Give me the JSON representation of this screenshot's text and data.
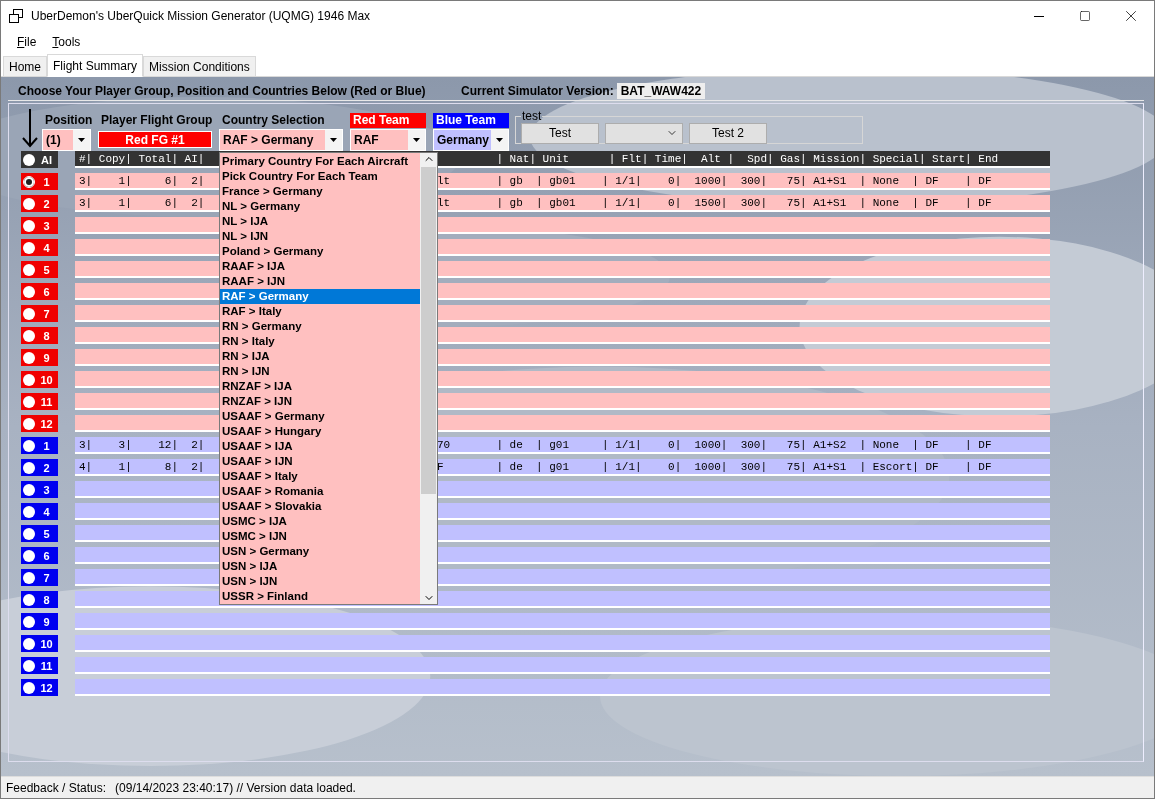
{
  "window": {
    "title": "UberDemon's UberQuick Mission Generator (UQMG) 1946 Max"
  },
  "menu": [
    {
      "label": "File"
    },
    {
      "label": "Tools"
    }
  ],
  "tabs": [
    {
      "label": "Home",
      "selected": false
    },
    {
      "label": "Flight Summary",
      "selected": true
    },
    {
      "label": "Mission Conditions",
      "selected": false
    }
  ],
  "instructions": "Choose Your Player Group, Position and Countries Below (Red or Blue)",
  "simulator_version": {
    "label": "Current Simulator Version:",
    "value": "BAT_WAW422"
  },
  "controls": {
    "position": {
      "label": "Position",
      "value": "(1)"
    },
    "player_flight_group": {
      "label": "Player Flight Group",
      "value": "Red FG #1"
    },
    "country_selection": {
      "label": "Country Selection",
      "value": "RAF > Germany"
    },
    "red_team": {
      "label": "Red Team",
      "value": "RAF"
    },
    "blue_team": {
      "label": "Blue Team",
      "value": "Germany"
    }
  },
  "test_group": {
    "title": "test",
    "items": [
      {
        "kind": "button",
        "label": "Test"
      },
      {
        "kind": "combo"
      },
      {
        "kind": "button",
        "label": "Test 2"
      }
    ]
  },
  "table": {
    "ai_header": {
      "label": "AI",
      "selected": false
    },
    "header_start": "#| Copy| Total| AI|",
    "header_end": "         | Nat| Unit      | Flt| Time|  Alt |  Spd| Gas| Mission| Special| Start| End",
    "rows": [
      {
        "kind": "red",
        "number": "1",
        "selected": true,
        "start": "3|    1|     6|  2|",
        "end": "lt       | gb  | gb01    | 1/1|    0|  1000|  300|   75| A1+S1  | None  | DF    | DF"
      },
      {
        "kind": "red",
        "number": "2",
        "selected": false,
        "start": "3|    1|     6|  2|",
        "end": "lt       | gb  | gb01    | 1/1|    0|  1500|  300|   75| A1+S1  | None  | DF    | DF"
      },
      {
        "kind": "red",
        "number": "3",
        "selected": false
      },
      {
        "kind": "red",
        "number": "4",
        "selected": false
      },
      {
        "kind": "red",
        "number": "5",
        "selected": false
      },
      {
        "kind": "red",
        "number": "6",
        "selected": false
      },
      {
        "kind": "red",
        "number": "7",
        "selected": false
      },
      {
        "kind": "red",
        "number": "8",
        "selected": false
      },
      {
        "kind": "red",
        "number": "9",
        "selected": false
      },
      {
        "kind": "red",
        "number": "10",
        "selected": false
      },
      {
        "kind": "red",
        "number": "11",
        "selected": false
      },
      {
        "kind": "red",
        "number": "12",
        "selected": false
      },
      {
        "kind": "blue",
        "number": "1",
        "selected": false,
        "start": "3|    3|    12|  2|",
        "end": "70       | de  | g01     | 1/1|    0|  1000|  300|   75| A1+S2  | None  | DF    | DF"
      },
      {
        "kind": "blue",
        "number": "2",
        "selected": false,
        "start": "4|    1|     8|  2|",
        "end": "F        | de  | g01     | 1/1|    0|  1000|  300|   75| A1+S1  | Escort| DF    | DF"
      },
      {
        "kind": "blue",
        "number": "3",
        "selected": false
      },
      {
        "kind": "blue",
        "number": "4",
        "selected": false
      },
      {
        "kind": "blue",
        "number": "5",
        "selected": false
      },
      {
        "kind": "blue",
        "number": "6",
        "selected": false
      },
      {
        "kind": "blue",
        "number": "7",
        "selected": false
      },
      {
        "kind": "blue",
        "number": "8",
        "selected": false
      },
      {
        "kind": "blue",
        "number": "9",
        "selected": false
      },
      {
        "kind": "blue",
        "number": "10",
        "selected": false
      },
      {
        "kind": "blue",
        "number": "11",
        "selected": false
      },
      {
        "kind": "blue",
        "number": "12",
        "selected": false
      }
    ]
  },
  "dropdown": {
    "items": [
      {
        "label": "Primary Country For Each Aircraft",
        "selected": false
      },
      {
        "label": "Pick Country For Each Team",
        "selected": false
      },
      {
        "label": "France > Germany",
        "selected": false
      },
      {
        "label": "NL > Germany",
        "selected": false
      },
      {
        "label": "NL > IJA",
        "selected": false
      },
      {
        "label": "NL > IJN",
        "selected": false
      },
      {
        "label": "Poland > Germany",
        "selected": false
      },
      {
        "label": "RAAF > IJA",
        "selected": false
      },
      {
        "label": "RAAF > IJN",
        "selected": false
      },
      {
        "label": "RAF > Germany",
        "selected": true
      },
      {
        "label": "RAF > Italy",
        "selected": false
      },
      {
        "label": "RN > Germany",
        "selected": false
      },
      {
        "label": "RN > Italy",
        "selected": false
      },
      {
        "label": "RN > IJA",
        "selected": false
      },
      {
        "label": "RN > IJN",
        "selected": false
      },
      {
        "label": "RNZAF > IJA",
        "selected": false
      },
      {
        "label": "RNZAF > IJN",
        "selected": false
      },
      {
        "label": "USAAF > Germany",
        "selected": false
      },
      {
        "label": "USAAF > Hungary",
        "selected": false
      },
      {
        "label": "USAAF > IJA",
        "selected": false
      },
      {
        "label": "USAAF > IJN",
        "selected": false
      },
      {
        "label": "USAAF > Italy",
        "selected": false
      },
      {
        "label": "USAAF > Romania",
        "selected": false
      },
      {
        "label": "USAAF > Slovakia",
        "selected": false
      },
      {
        "label": "USMC > IJA",
        "selected": false
      },
      {
        "label": "USMC > IJN",
        "selected": false
      },
      {
        "label": "USN > Germany",
        "selected": false
      },
      {
        "label": "USN > IJA",
        "selected": false
      },
      {
        "label": "USN > IJN",
        "selected": false
      },
      {
        "label": "USSR > Finland",
        "selected": false
      }
    ]
  },
  "status_bar": {
    "label": "Feedback / Status:",
    "message": "(09/14/2023 23:40:17) // Version data loaded."
  }
}
